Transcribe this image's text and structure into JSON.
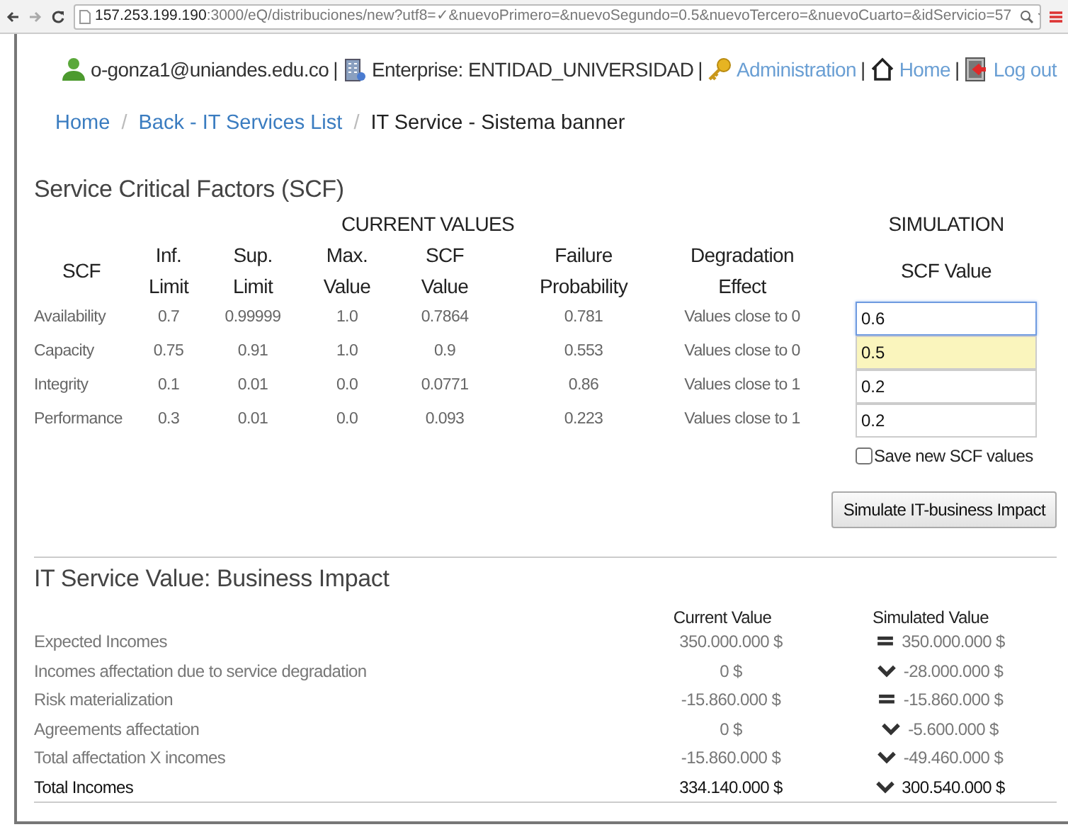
{
  "browser": {
    "url_host": "157.253.199.190",
    "url_path": ":3000/eQ/distribuciones/new?utf8=✓&nuevoPrimero=&nuevoSegundo=0.5&nuevoTercero=&nuevoCuarto=&idServicio=57"
  },
  "header": {
    "user": "o-gonza1@uniandes.edu.co",
    "separator": "|",
    "enterprise": "Enterprise: ENTIDAD_UNIVERSIDAD",
    "links": [
      {
        "kind": "key",
        "label": "Administration"
      },
      {
        "kind": "home",
        "label": "Home"
      },
      {
        "kind": "logout",
        "label": "Log out"
      }
    ]
  },
  "breadcrumb_separator": "/",
  "breadcrumb": [
    {
      "label": "Home",
      "selected": false
    },
    {
      "label": "Back - IT Services List",
      "selected": false
    },
    {
      "label": "IT Service - Sistema banner",
      "selected": true
    }
  ],
  "scf": {
    "title": "Service Critical Factors (SCF)",
    "group_current": "CURRENT VALUES",
    "group_simulation": "SIMULATION",
    "columns": [
      "SCF",
      "Inf. Limit",
      "Sup. Limit",
      "Max. Value",
      "SCF Value",
      "Failure Probability",
      "Degradation Effect",
      "SCF Value"
    ],
    "rows": [
      {
        "name": "Availability",
        "inf": "0.7",
        "sup": "0.99999",
        "max": "1.0",
        "value": "0.7864",
        "failure": "0.781",
        "effect": "Values close to 0",
        "simulation": "0.6",
        "focused": true,
        "highlighted": false
      },
      {
        "name": "Capacity",
        "inf": "0.75",
        "sup": "0.91",
        "max": "1.0",
        "value": "0.9",
        "failure": "0.553",
        "effect": "Values close to 0",
        "simulation": "0.5",
        "focused": false,
        "highlighted": true
      },
      {
        "name": "Integrity",
        "inf": "0.1",
        "sup": "0.01",
        "max": "0.0",
        "value": "0.0771",
        "failure": "0.86",
        "effect": "Values close to 1",
        "simulation": "0.2",
        "focused": false,
        "highlighted": false
      },
      {
        "name": "Performance",
        "inf": "0.3",
        "sup": "0.01",
        "max": "0.0",
        "value": "0.093",
        "failure": "0.223",
        "effect": "Values close to 1",
        "simulation": "0.2",
        "focused": false,
        "highlighted": false
      }
    ],
    "save": {
      "label": "Save new SCF values",
      "checked": false
    },
    "button": "Simulate IT-business Impact"
  },
  "impact": {
    "title": "IT Service Value: Business Impact",
    "columns": [
      "Current Value",
      "Simulated Value"
    ],
    "rows": [
      {
        "label": "Expected Incomes",
        "current": "350.000.000 $",
        "simulated": "350.000.000 $",
        "kind": "equal",
        "total": false
      },
      {
        "label": "Incomes affectation due to service degradation",
        "current": "0 $",
        "simulated": "-28.000.000 $",
        "kind": "down",
        "total": false
      },
      {
        "label": "Risk materialization",
        "current": "-15.860.000 $",
        "simulated": "-15.860.000 $",
        "kind": "equal",
        "total": false
      },
      {
        "label": "Agreements affectation",
        "current": "0 $",
        "simulated": "-5.600.000 $",
        "kind": "down",
        "total": false
      },
      {
        "label": "Total affectation X incomes",
        "current": "-15.860.000 $",
        "simulated": "-49.460.000 $",
        "kind": "down",
        "total": false
      },
      {
        "label": "Total Incomes",
        "current": "334.140.000 $",
        "simulated": "300.540.000 $",
        "kind": "down",
        "total": true
      }
    ]
  }
}
